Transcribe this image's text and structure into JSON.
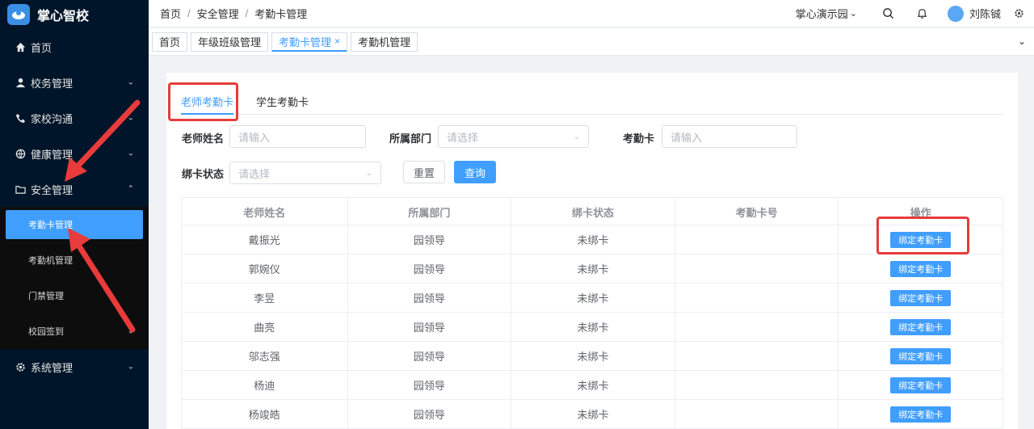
{
  "app": {
    "title": "掌心智校"
  },
  "sidebar": {
    "items": [
      {
        "label": "首页",
        "icon": "home-icon"
      },
      {
        "label": "校务管理",
        "icon": "user-icon",
        "expandable": true
      },
      {
        "label": "家校沟通",
        "icon": "phone-icon",
        "expandable": true
      },
      {
        "label": "健康管理",
        "icon": "health-icon",
        "expandable": true
      },
      {
        "label": "安全管理",
        "icon": "folder-icon",
        "expandable": true,
        "expanded": true
      },
      {
        "label": "系统管理",
        "icon": "gear-icon",
        "expandable": true
      }
    ],
    "sub_items": [
      {
        "label": "考勤卡管理",
        "active": true
      },
      {
        "label": "考勤机管理"
      },
      {
        "label": "门禁管理"
      },
      {
        "label": "校园签到",
        "expandable": true
      }
    ]
  },
  "header": {
    "breadcrumb": [
      "首页",
      "安全管理",
      "考勤卡管理"
    ],
    "breadcrumb_sep": "/",
    "org": "掌心演示园",
    "user": "刘陈铖"
  },
  "tags": {
    "items": [
      "首页",
      "年级班级管理",
      "考勤卡管理",
      "考勤机管理"
    ],
    "active_index": 2,
    "close": "×"
  },
  "main": {
    "tabs": [
      "老师考勤卡",
      "学生考勤卡"
    ],
    "active_tab": 0,
    "form": {
      "teacher_name_label": "老师姓名",
      "teacher_name_placeholder": "请输入",
      "dept_label": "所属部门",
      "dept_placeholder": "请选择",
      "card_label": "考勤卡",
      "card_placeholder": "请输入",
      "bind_status_label": "绑卡状态",
      "bind_status_placeholder": "请选择",
      "reset_label": "重置",
      "query_label": "查询"
    },
    "table": {
      "columns": [
        "老师姓名",
        "所属部门",
        "绑卡状态",
        "考勤卡号",
        "操作"
      ],
      "action_label": "绑定考勤卡",
      "rows": [
        {
          "name": "戴振光",
          "dept": "园领导",
          "status": "未绑卡",
          "card": ""
        },
        {
          "name": "郭婉仪",
          "dept": "园领导",
          "status": "未绑卡",
          "card": ""
        },
        {
          "name": "李昱",
          "dept": "园领导",
          "status": "未绑卡",
          "card": ""
        },
        {
          "name": "曲亮",
          "dept": "园领导",
          "status": "未绑卡",
          "card": ""
        },
        {
          "name": "邬志强",
          "dept": "园领导",
          "status": "未绑卡",
          "card": ""
        },
        {
          "name": "杨迪",
          "dept": "园领导",
          "status": "未绑卡",
          "card": ""
        },
        {
          "name": "杨竣皓",
          "dept": "园领导",
          "status": "未绑卡",
          "card": ""
        }
      ]
    }
  },
  "colors": {
    "sidebar_bg": "#001529",
    "accent": "#409eff",
    "annotation_red": "#e83b3b"
  }
}
